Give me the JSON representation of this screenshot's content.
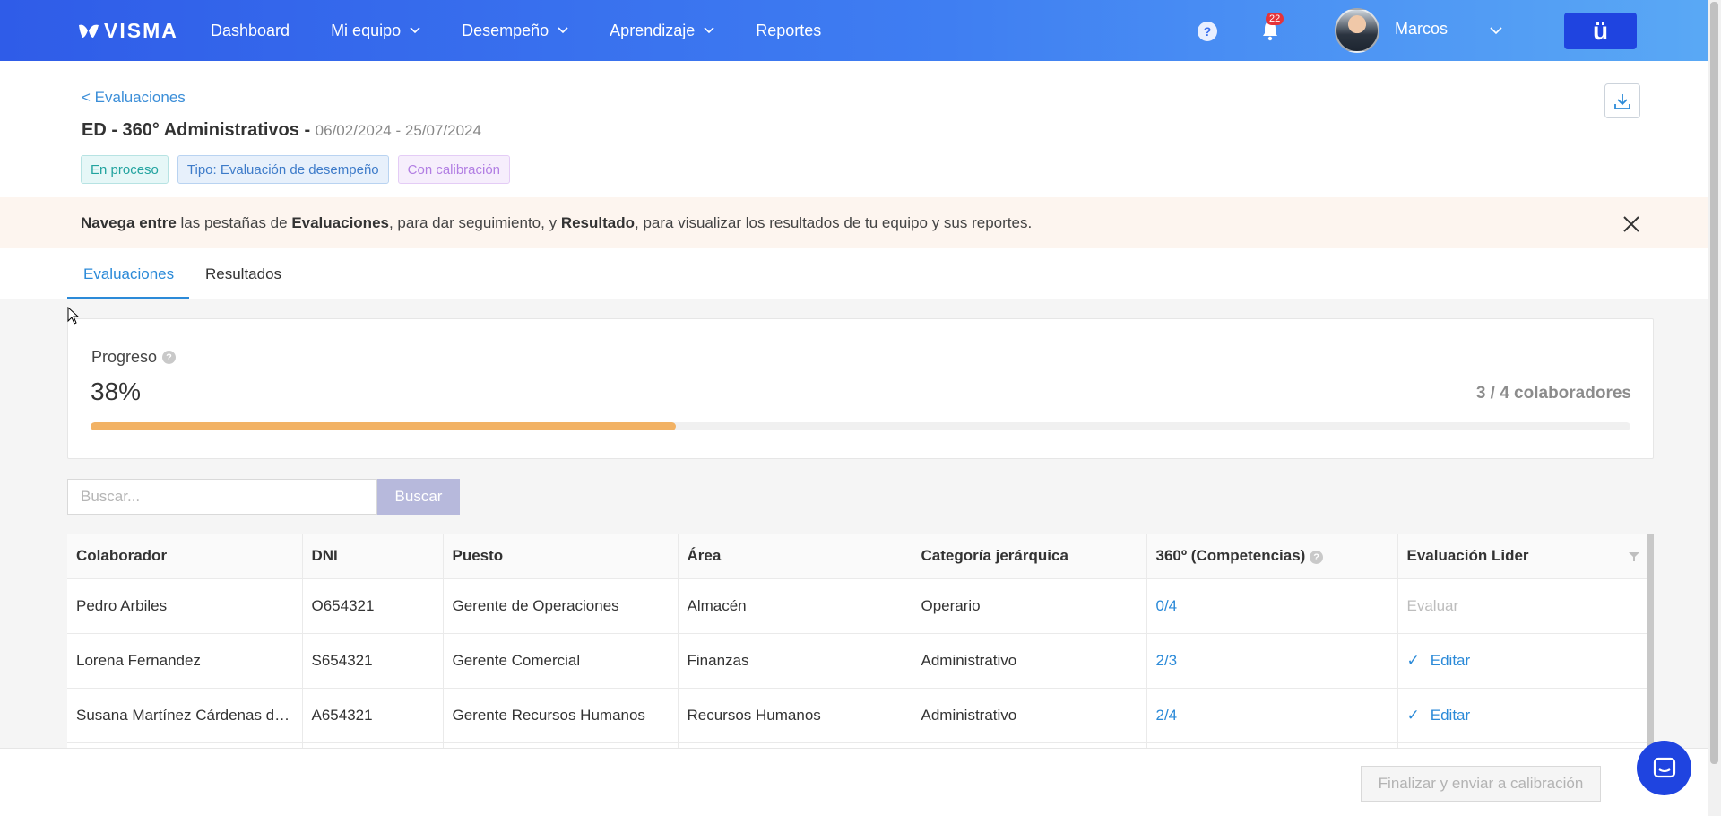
{
  "nav": {
    "logo": "VISMA",
    "items": [
      {
        "label": "Dashboard",
        "dropdown": false
      },
      {
        "label": "Mi equipo",
        "dropdown": true
      },
      {
        "label": "Desempeño",
        "dropdown": true
      },
      {
        "label": "Aprendizaje",
        "dropdown": true
      },
      {
        "label": "Reportes",
        "dropdown": false
      }
    ],
    "help_icon": "?",
    "notifications_count": "22",
    "user_name": "Marcos",
    "brand_button": "ü"
  },
  "header": {
    "back_link": "< Evaluaciones",
    "title": "ED - 360° Administrativos -",
    "dates": "06/02/2024 - 25/07/2024",
    "tags": [
      "En proceso",
      "Tipo: Evaluación de desempeño",
      "Con calibración"
    ]
  },
  "banner": {
    "p1": "Navega entre",
    "p2": " las pestañas de ",
    "p3": "Evaluaciones",
    "p4": ", para dar seguimiento, y ",
    "p5": "Resultado",
    "p6": ", para visualizar los resultados de tu equipo y sus reportes."
  },
  "tabs": [
    "Evaluaciones",
    "Resultados"
  ],
  "progress": {
    "label": "Progreso",
    "percent_text": "38%",
    "percent_value": 0.38,
    "count_text": "3 / 4 colaboradores"
  },
  "search": {
    "placeholder": "Buscar...",
    "button": "Buscar"
  },
  "table": {
    "headers": [
      "Colaborador",
      "DNI",
      "Puesto",
      "Área",
      "Categoría jerárquica",
      "360º (Competencias)",
      "Evaluación Lider"
    ],
    "rows": [
      {
        "colaborador": "Pedro Arbiles",
        "dni": "O654321",
        "puesto": "Gerente de Operaciones",
        "area": "Almacén",
        "categoria": "Operario",
        "competencias": "0/4",
        "lider": "Evaluar",
        "lider_done": false
      },
      {
        "colaborador": "Lorena Fernandez",
        "dni": "S654321",
        "puesto": "Gerente Comercial",
        "area": "Finanzas",
        "categoria": "Administrativo",
        "competencias": "2/3",
        "lider": "Editar",
        "lider_done": true
      },
      {
        "colaborador": "Susana Martínez Cárdenas de...",
        "dni": "A654321",
        "puesto": "Gerente Recursos Humanos",
        "area": "Recursos Humanos",
        "categoria": "Administrativo",
        "competencias": "2/4",
        "lider": "Editar",
        "lider_done": true
      }
    ]
  },
  "footer": {
    "finalize_button": "Finalizar y enviar a calibración"
  },
  "colors": {
    "nav_start": "#2f5ce8",
    "nav_end": "#5aa9f5",
    "accent": "#2b8ad8",
    "progress": "#f2b264",
    "brand": "#1f44e0"
  }
}
